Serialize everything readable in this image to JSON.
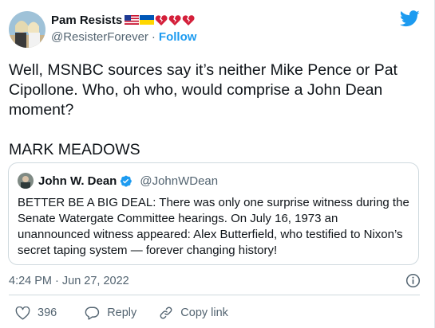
{
  "author": {
    "display_name": "Pam Resists",
    "handle": "@ResisterForever",
    "separator": "·",
    "follow_label": "Follow",
    "flag_icons": [
      "us-flag-icon",
      "ukraine-flag-icon",
      "broken-heart-icon",
      "broken-heart-icon",
      "broken-heart-icon"
    ]
  },
  "tweet": {
    "paragraph_1": "Well, MSNBC sources say it’s neither Mike Pence or Pat Cipollone. Who, oh who, would comprise a John Dean moment?",
    "paragraph_2": "MARK MEADOWS",
    "timestamp": "4:24 PM · Jun 27, 2022"
  },
  "quoted_tweet": {
    "display_name": "John W. Dean",
    "handle": "@JohnWDean",
    "text": "BETTER BE A BIG DEAL: There was only one surprise witness during the Senate Watergate Committee hearings. On July 16, 1973 an unannounced witness appeared: Alex Butterfield, who testified to Nixon’s secret taping system — forever changing history!"
  },
  "actions": {
    "like_count": "396",
    "reply_label": "Reply",
    "copy_link_label": "Copy link"
  },
  "colors": {
    "accent": "#1d9bf0",
    "text": "#0f1419",
    "secondary": "#536471",
    "border": "#cfd9de",
    "heart": "#d41f3a"
  }
}
